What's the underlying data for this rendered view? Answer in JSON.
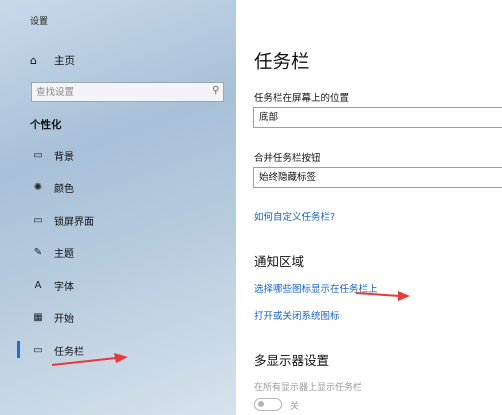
{
  "window": {
    "title": "设置"
  },
  "sidebar": {
    "home": {
      "icon": "home-icon",
      "label": "主页"
    },
    "search": {
      "placeholder": "查找设置",
      "icon": "search-icon"
    },
    "section_title": "个性化",
    "items": [
      {
        "icon": "background-icon",
        "label": "背景"
      },
      {
        "icon": "palette-icon",
        "label": "颜色"
      },
      {
        "icon": "lockscreen-icon",
        "label": "锁屏界面"
      },
      {
        "icon": "theme-icon",
        "label": "主题"
      },
      {
        "icon": "font-icon",
        "label": "字体"
      },
      {
        "icon": "start-icon",
        "label": "开始"
      },
      {
        "icon": "taskbar-icon",
        "label": "任务栏",
        "active": true
      }
    ]
  },
  "main": {
    "title": "任务栏",
    "position_label": "任务栏在屏幕上的位置",
    "position_value": "底部",
    "combine_label": "合并任务栏按钮",
    "combine_value": "始终隐藏标签",
    "customize_link": "如何自定义任务栏?",
    "notification_heading": "通知区域",
    "select_icons_link": "选择哪些图标显示在任务栏上",
    "system_icons_link": "打开或关闭系统图标",
    "multi_display_heading": "多显示器设置",
    "show_all_displays_label": "在所有显示器上显示任务栏",
    "toggle_state": "关"
  },
  "colors": {
    "accent": "#1663c7",
    "annotation_arrow": "#e83a3a"
  }
}
